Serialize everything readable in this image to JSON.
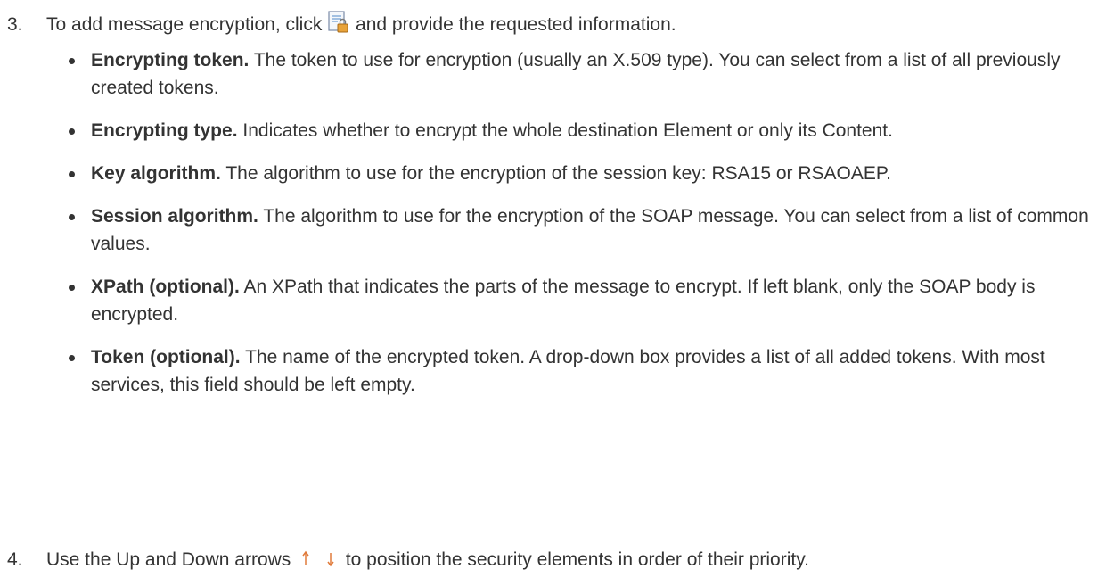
{
  "step3": {
    "number": "3.",
    "text_before": "To add message encryption, click",
    "icon": "encrypt-document-lock-icon",
    "text_after": "and provide the requested information."
  },
  "bullets": [
    {
      "term": "Encrypting token.",
      "desc": "The token to use for encryption (usually an X.509 type). You can select from a list of all previously created tokens."
    },
    {
      "term": "Encrypting type.",
      "desc": "Indicates whether to encrypt the whole destination Element or only its Content."
    },
    {
      "term": "Key algorithm.",
      "desc": "The algorithm to use for the encryption of the session key: RSA15 or RSAOAEP."
    },
    {
      "term": "Session algorithm.",
      "desc": "The algorithm to use for the encryption of the SOAP message. You can select from a list of common values."
    },
    {
      "term": "XPath (optional).",
      "desc": "An XPath that indicates the parts of the message to encrypt. If left blank, only the SOAP body is encrypted."
    },
    {
      "term": "Token (optional).",
      "desc": "The name of the encrypted token. A drop-down box provides a list of all added tokens. With most services, this field should be left empty."
    }
  ],
  "step4": {
    "number": "4.",
    "text_before": "Use the Up and Down arrows",
    "icons": [
      "up-arrow-icon",
      "down-arrow-icon"
    ],
    "text_after": "to position the security elements in order of their priority."
  },
  "colors": {
    "text": "#333333",
    "icon_arrow": "#e07a3a",
    "icon_lock": "#e8a33a"
  }
}
